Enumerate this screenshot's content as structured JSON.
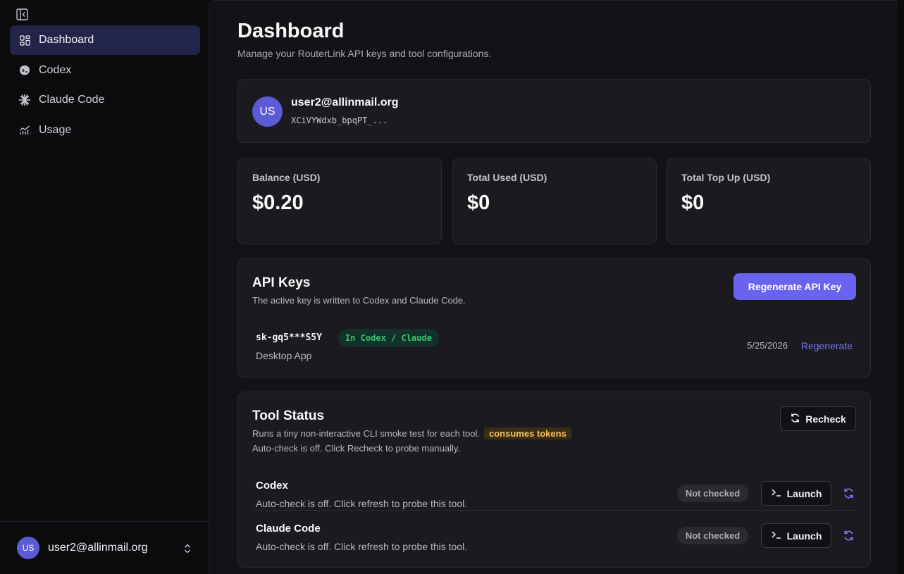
{
  "sidebar": {
    "items": [
      {
        "label": "Dashboard",
        "icon": "dashboard-icon",
        "active": true
      },
      {
        "label": "Codex",
        "icon": "codex-icon"
      },
      {
        "label": "Claude Code",
        "icon": "claude-icon"
      },
      {
        "label": "Usage",
        "icon": "chart-icon"
      }
    ],
    "footer": {
      "avatar": "US",
      "email": "user2@allinmail.org"
    }
  },
  "header": {
    "title": "Dashboard",
    "subtitle": "Manage your RouterLink API keys and tool configurations."
  },
  "user": {
    "avatar": "US",
    "email": "user2@allinmail.org",
    "key_preview": "XCiVYWdxb_bpqPT_..."
  },
  "stats": [
    {
      "label": "Balance (USD)",
      "value": "$0.20"
    },
    {
      "label": "Total Used (USD)",
      "value": "$0"
    },
    {
      "label": "Total Top Up (USD)",
      "value": "$0"
    }
  ],
  "api_keys": {
    "title": "API Keys",
    "description": "The active key is written to Codex and Claude Code.",
    "regenerate_button": "Regenerate API Key",
    "key": {
      "name": "sk-gq5***S5Y",
      "badge": "In Codex / Claude",
      "device": "Desktop App",
      "date": "5/25/2026",
      "action": "Regenerate"
    }
  },
  "tool_status": {
    "title": "Tool Status",
    "description": "Runs a tiny non-interactive CLI smoke test for each tool.",
    "badge": "consumes tokens",
    "note": "Auto-check is off. Click Recheck to probe manually.",
    "recheck_button": "Recheck",
    "tools": [
      {
        "name": "Codex",
        "desc": "Auto-check is off. Click refresh to probe this tool.",
        "status": "Not checked",
        "launch": "Launch"
      },
      {
        "name": "Claude Code",
        "desc": "Auto-check is off. Click refresh to probe this tool.",
        "status": "Not checked",
        "launch": "Launch"
      }
    ]
  },
  "colors": {
    "accent": "#6a63f0",
    "active_nav": "#23244a",
    "success": "#34c46a",
    "warning": "#f3c15c"
  }
}
